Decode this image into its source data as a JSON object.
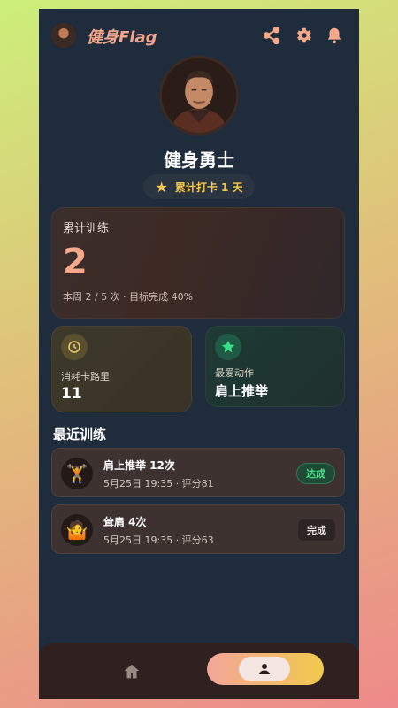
{
  "app": {
    "title": "健身Flag"
  },
  "colors": {
    "accent": "#f5a98a",
    "gold": "#f2c94c",
    "success": "#4be08a",
    "background": "#1e2c3c"
  },
  "icons": {
    "share": "share-icon",
    "settings": "gear-icon",
    "notifications": "bell-icon"
  },
  "profile": {
    "name": "健身勇士",
    "streak": "累计打卡 1 天"
  },
  "stats": {
    "total_title": "累计训练",
    "total_value": "2",
    "total_sub": "本周 2 / 5 次 · 目标完成 40%",
    "calories_label": "消耗卡路里",
    "calories_value": "11",
    "favorite_label": "最爱动作",
    "favorite_value": "肩上推举"
  },
  "recent": {
    "title": "最近训练",
    "items": [
      {
        "icon": "🏋️",
        "title": "肩上推举 12次",
        "meta": "5月25日 19:35 · 评分81",
        "badge": "达成"
      },
      {
        "icon": "🤷",
        "title": "耸肩 4次",
        "meta": "5月25日 19:35 · 评分63",
        "badge": "完成"
      }
    ]
  },
  "nav": {
    "home": "home-icon",
    "profile": "profile-icon",
    "active": "profile"
  }
}
